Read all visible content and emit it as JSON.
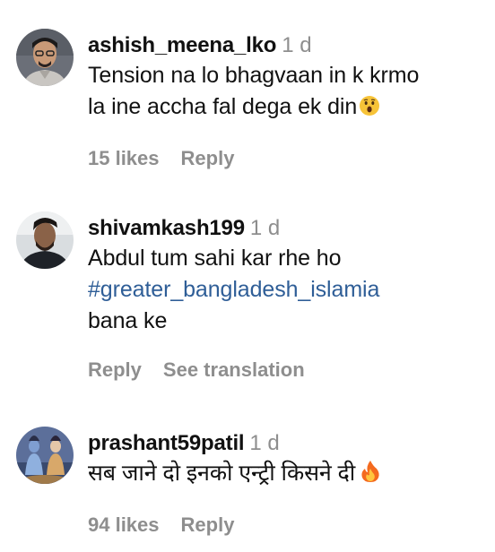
{
  "comments": [
    {
      "username": "ashish_meena_lko",
      "time": "1 d",
      "text_line1": "Tension na lo bhagvaan in k krmo",
      "text_line2": "la ine accha fal dega ek din",
      "emoji": "astonished-face",
      "likes": "15 likes",
      "reply": "Reply"
    },
    {
      "username": "shivamkash199",
      "time": "1 d",
      "text_line1": "Abdul tum sahi kar rhe ho",
      "hashtag": "#greater_bangladesh_islamia",
      "text_line3": "bana ke",
      "reply": "Reply",
      "see_translation": "See translation"
    },
    {
      "username": "prashant59patil",
      "time": "1 d",
      "text": "सब जाने दो इनको एन्ट्री किसने दी",
      "emoji": "fire",
      "likes": "94 likes",
      "reply": "Reply"
    }
  ],
  "colors": {
    "muted": "#8e8e8e",
    "hashtag": "#2f5e97",
    "text": "#111111"
  }
}
